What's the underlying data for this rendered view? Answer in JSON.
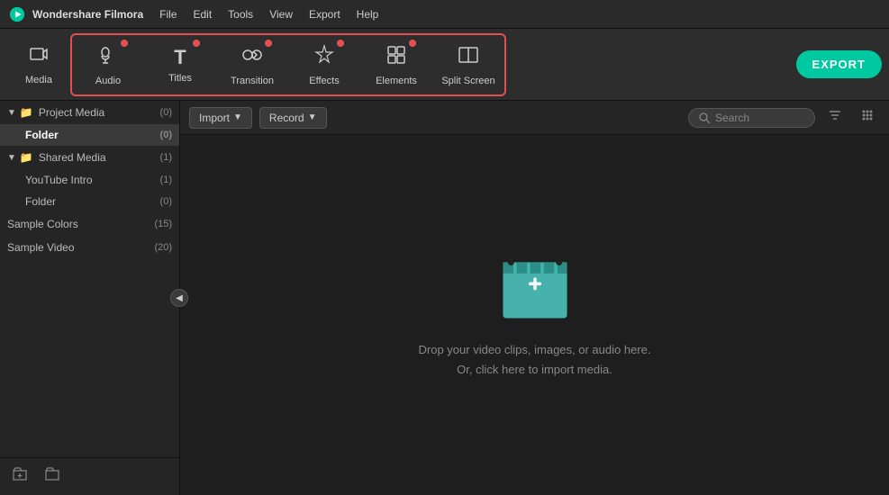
{
  "app": {
    "name": "Wondershare Filmora",
    "logo_color": "#00c8a0"
  },
  "menu": {
    "items": [
      "File",
      "Edit",
      "Tools",
      "View",
      "Export",
      "Help"
    ]
  },
  "toolbar": {
    "media_label": "Media",
    "export_label": "EXPORT",
    "items": [
      {
        "id": "audio",
        "label": "Audio",
        "icon": "♪",
        "dot": true
      },
      {
        "id": "titles",
        "label": "Titles",
        "icon": "T",
        "dot": true
      },
      {
        "id": "transition",
        "label": "Transition",
        "icon": "⇄",
        "dot": true
      },
      {
        "id": "effects",
        "label": "Effects",
        "icon": "✦",
        "dot": true
      },
      {
        "id": "elements",
        "label": "Elements",
        "icon": "⊞",
        "dot": true
      },
      {
        "id": "split_screen",
        "label": "Split Screen",
        "icon": "⧉",
        "dot": false
      }
    ]
  },
  "panel_toolbar": {
    "import_label": "Import",
    "record_label": "Record",
    "search_placeholder": "Search"
  },
  "sidebar": {
    "project_media": {
      "label": "Project Media",
      "count": "(0)",
      "folder_label": "Folder",
      "folder_count": "(0)"
    },
    "shared_media": {
      "label": "Shared Media",
      "count": "(1)",
      "children": [
        {
          "label": "YouTube Intro",
          "count": "(1)"
        },
        {
          "label": "Folder",
          "count": "(0)"
        }
      ]
    },
    "sample_colors": {
      "label": "Sample Colors",
      "count": "(15)"
    },
    "sample_video": {
      "label": "Sample Video",
      "count": "(20)"
    }
  },
  "drop_area": {
    "line1": "Drop your video clips, images, or audio here.",
    "line2": "Or, click here to import media."
  }
}
